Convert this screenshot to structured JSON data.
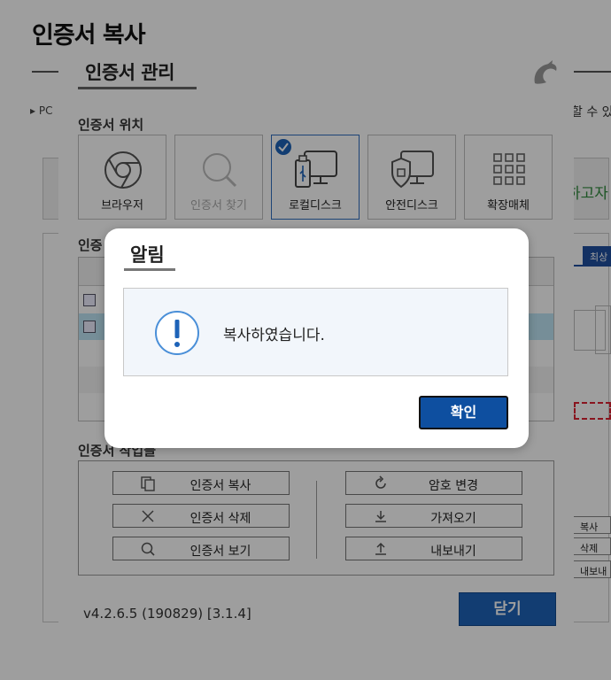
{
  "background": {
    "page_title": "인증서 복사",
    "bullet_text": "▸ PC",
    "right_text": "할 수 있",
    "green_text": "하고자",
    "tab_text": "최상",
    "mini_buttons": [
      "복사",
      "삭제",
      "내보내"
    ]
  },
  "cert_dialog": {
    "title": "인증서 관리",
    "location_label": "인증서 위치",
    "locations": [
      {
        "label": "브라우저",
        "icon": "chrome-icon",
        "state": "normal"
      },
      {
        "label": "인증서 찾기",
        "icon": "magnifier-icon",
        "state": "disabled"
      },
      {
        "label": "로컬디스크",
        "icon": "usb-monitor-icon",
        "state": "selected"
      },
      {
        "label": "안전디스크",
        "icon": "shield-monitor-icon",
        "state": "normal"
      },
      {
        "label": "확장매체",
        "icon": "grid-icon",
        "state": "normal"
      }
    ],
    "list_label": "인증",
    "actions_label": "인증서 작업들",
    "actions_left": [
      {
        "label": "인증서 복사",
        "icon": "copy-icon"
      },
      {
        "label": "인증서 삭제",
        "icon": "x-icon"
      },
      {
        "label": "인증서 보기",
        "icon": "search-icon"
      }
    ],
    "actions_right": [
      {
        "label": "암호 변경",
        "icon": "refresh-icon"
      },
      {
        "label": "가져오기",
        "icon": "download-icon"
      },
      {
        "label": "내보내기",
        "icon": "upload-icon"
      }
    ],
    "version": "v4.2.6.5 (190829) [3.1.4]",
    "close_label": "닫기"
  },
  "alert": {
    "title": "알림",
    "message": "복사하였습니다.",
    "ok_label": "확인",
    "icon": "exclamation-icon"
  },
  "colors": {
    "accent": "#1d63b8",
    "ok_button": "#0e4fa0",
    "alert_body": "#f2f6fb",
    "selected_row": "#bfe6f5"
  }
}
